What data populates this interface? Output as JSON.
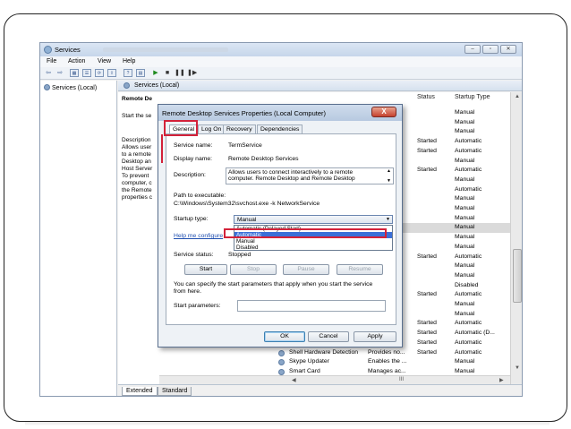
{
  "window": {
    "title": "Services"
  },
  "menu": [
    "File",
    "Action",
    "View",
    "Help"
  ],
  "tree": {
    "root": "Services (Local)"
  },
  "panel": {
    "header": "Services (Local)"
  },
  "description": {
    "title": "Remote De",
    "start_link": "Start",
    "start_rest": "the se",
    "lines": [
      "Description",
      "Allows user",
      "to a remote",
      "Desktop an",
      "Host Server",
      "To prevent",
      "computer, c",
      "the Remote",
      "properties c"
    ]
  },
  "columns": {
    "status": "Status",
    "startup_type": "Startup Type"
  },
  "rows": [
    {
      "status": "",
      "type": "Manual"
    },
    {
      "status": "",
      "type": "Manual"
    },
    {
      "status": "",
      "type": "Manual"
    },
    {
      "status": "Started",
      "type": "Automatic"
    },
    {
      "status": "Started",
      "type": "Automatic"
    },
    {
      "status": "",
      "type": "Manual"
    },
    {
      "status": "Started",
      "type": "Automatic"
    },
    {
      "status": "",
      "type": "Manual"
    },
    {
      "status": "",
      "type": "Automatic"
    },
    {
      "status": "",
      "type": "Manual"
    },
    {
      "status": "",
      "type": "Manual"
    },
    {
      "status": "",
      "type": "Manual"
    },
    {
      "status": "",
      "type": "Manual"
    },
    {
      "status": "",
      "type": "Manual"
    },
    {
      "status": "",
      "type": "Manual"
    },
    {
      "status": "Started",
      "type": "Automatic"
    },
    {
      "status": "",
      "type": "Manual"
    },
    {
      "status": "",
      "type": "Manual"
    },
    {
      "status": "",
      "type": "Disabled"
    },
    {
      "status": "Started",
      "type": "Automatic"
    },
    {
      "status": "",
      "type": "Manual"
    },
    {
      "status": "",
      "type": "Manual"
    },
    {
      "status": "Started",
      "type": "Automatic"
    },
    {
      "status": "Started",
      "type": "Automatic (D..."
    },
    {
      "status": "Started",
      "type": "Automatic"
    },
    {
      "name": "Shell Hardware Detection",
      "desc": "Provides no...",
      "status": "Started",
      "type": "Automatic"
    },
    {
      "name": "Skype Updater",
      "desc": "Enables the ...",
      "status": "",
      "type": "Manual"
    },
    {
      "name": "Smart Card",
      "desc": "Manages ac...",
      "status": "",
      "type": "Manual"
    }
  ],
  "hscroll": {
    "thumb": "III"
  },
  "bottom_tabs": [
    "Extended",
    "Standard"
  ],
  "dialog": {
    "title": "Remote Desktop Services Properties (Local Computer)",
    "close": "X",
    "tabs": [
      "General",
      "Log On",
      "Recovery",
      "Dependencies"
    ],
    "service_name_label": "Service name:",
    "service_name": "TermService",
    "display_name_label": "Display name:",
    "display_name": "Remote Desktop Services",
    "description_label": "Description:",
    "description_lines": [
      "Allows users to connect interactively to a remote",
      "computer. Remote Desktop and Remote Desktop"
    ],
    "path_label": "Path to executable:",
    "path": "C:\\Windows\\System32\\svchost.exe -k NetworkService",
    "startup_type_label": "Startup type:",
    "startup_type": "Manual",
    "startup_options": [
      "Automatic (Delayed Start)",
      "Automatic",
      "Manual",
      "Disabled"
    ],
    "help_link": "Help me configure",
    "service_status_label": "Service status:",
    "service_status": "Stopped",
    "buttons": {
      "start": "Start",
      "stop": "Stop",
      "pause": "Pause",
      "resume": "Resume"
    },
    "hint_lines": [
      "You can specify the start parameters that apply when you start the service",
      "from here."
    ],
    "start_params_label": "Start parameters:",
    "ok": "OK",
    "cancel": "Cancel",
    "apply": "Apply"
  },
  "colors": {
    "highlight": "#d3223a",
    "selected_option": "#3a6fd8",
    "link": "#1f4fb0"
  }
}
